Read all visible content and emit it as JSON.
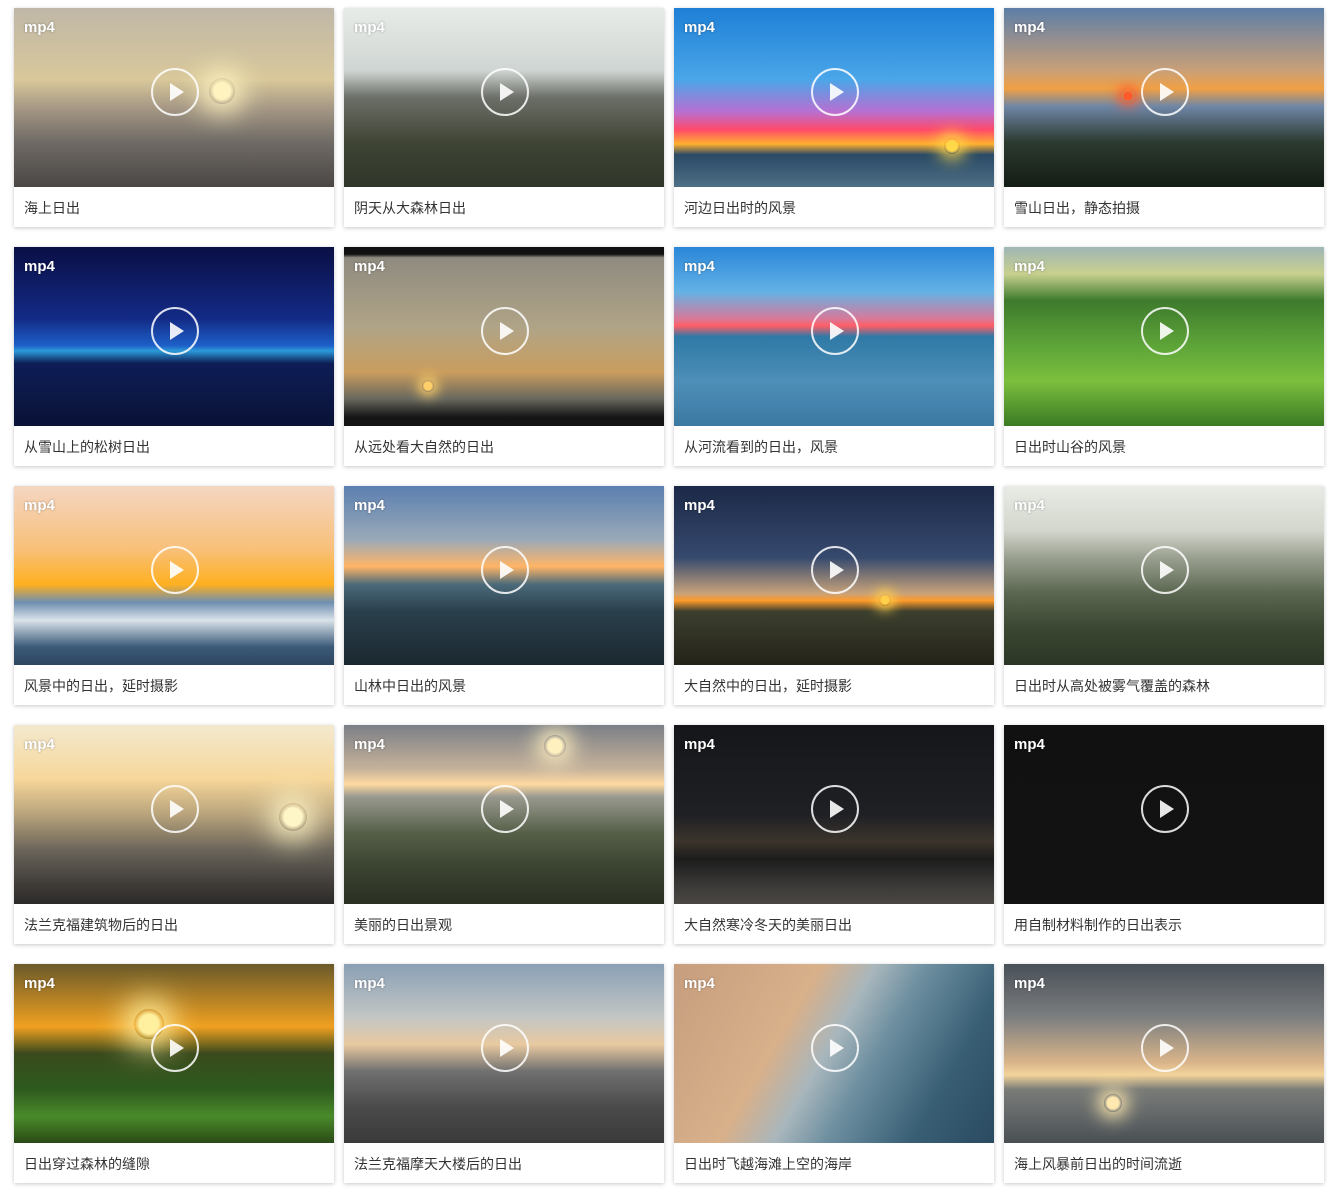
{
  "badge_label": "mp4",
  "videos": [
    {
      "title": "海上日出",
      "bg": "linear-gradient(180deg,#bfb7a8 0%,#d9c89a 40%,#a89a86 55%,#6f6a66 75%,#4b4744 100%)",
      "sun": "#fff3c0"
    },
    {
      "title": "阴天从大森林日出",
      "bg": "linear-gradient(180deg,#e8ece8 0%,#cfd5d2 35%,#6c6f68 50%,#3f4535 75%,#2f3528 100%)",
      "sun": ""
    },
    {
      "title": "河边日出时的风景",
      "bg": "linear-gradient(180deg,#1e7fd6 0%,#4aa6e8 40%,#b86fd2 58%,#ff4a6a 68%,#ffb02e 76%,#2a4a66 82%,#4f6f86 100%)",
      "sun": "#ffd84a"
    },
    {
      "title": "雪山日出，静态拍摄",
      "bg": "linear-gradient(180deg,#5d7ea8 0%,#c9a078 35%,#f0a044 45%,#6f86a6 55%,#2c3a2f 75%,#141c14 100%)",
      "sun": "#ff5a2a"
    },
    {
      "title": "从雪山上的松树日出",
      "bg": "linear-gradient(180deg,#0a0f45 0%,#132a86 40%,#1d5fc8 55%,#2b9ad8 58%,#0d1d56 65%,#0a1236 100%)",
      "sun": ""
    },
    {
      "title": "从远处看大自然的日出",
      "bg": "linear-gradient(180deg,#111 0%,#111 4%,#8f8b80 6%,#b0a487 45%,#c99d5e 70%,#67675e 85%,#151515 95%,#151515 100%)",
      "sun": "#ffcf6a"
    },
    {
      "title": "从河流看到的日出，风景",
      "bg": "linear-gradient(180deg,#2a86d8 0%,#63b2e6 25%,#d77a9a 40%,#ff5e66 44%,#2f79a6 50%,#4d8fb8 75%,#3b78a2 100%)",
      "sun": ""
    },
    {
      "title": "日出时山谷的风景",
      "bg": "linear-gradient(180deg,#9fb6b6 0%,#c8d08f 15%,#3e7a2c 30%,#5da438 55%,#7cbf3e 75%,#3a7a24 100%)",
      "sun": ""
    },
    {
      "title": "风景中的日出，延时摄影",
      "bg": "linear-gradient(180deg,#f4d6c2 0%,#f8c07a 35%,#ffb020 55%,#6f8eb0 65%,#d9e2ea 75%,#3b5a78 90%,#2e4660 100%)",
      "sun": ""
    },
    {
      "title": "山林中日出的风景",
      "bg": "linear-gradient(180deg,#5b7fb0 0%,#9aa9b8 30%,#ffb566 45%,#4b6a7a 55%,#2a3f4c 70%,#1b2830 100%)",
      "sun": ""
    },
    {
      "title": "大自然中的日出，延时摄影",
      "bg": "linear-gradient(180deg,#1c2847 0%,#364a6e 40%,#c7a27a 60%,#ff9a2a 64%,#3c3f2e 70%,#242319 100%)",
      "sun": "#ffd04a"
    },
    {
      "title": "日出时从高处被雾气覆盖的森林",
      "bg": "linear-gradient(180deg,#e9ece6 0%,#d2d6cc 25%,#9aa090 40%,#5a6650 60%,#3a4631 80%,#2c3626 100%)",
      "sun": ""
    },
    {
      "title": "法兰克福建筑物后的日出",
      "bg": "linear-gradient(180deg,#f3e9cf 0%,#f7d79a 30%,#b8a37c 50%,#6a6459 70%,#3d3a37 90%,#2c2a28 100%)",
      "sun": "#fff6c8"
    },
    {
      "title": "美丽的日出景观",
      "bg": "linear-gradient(180deg,#7b7f86 0%,#c8b39b 25%,#ffd9a0 33%,#9a9a90 40%,#566048 60%,#3a4230 80%,#2a3022 100%)",
      "sun": "#fff0c0"
    },
    {
      "title": "大自然寒冷冬天的美丽日出",
      "bg": "linear-gradient(180deg,#15161a 0%,#1f2024 50%,#3b342c 65%,#1c1c1c 75%,#3c3a38 90%,#4a4744 100%)",
      "sun": ""
    },
    {
      "title": "用自制材料制作的日出表示",
      "bg": "linear-gradient(180deg,#111111 0%,#121212 100%)",
      "sun": ""
    },
    {
      "title": "日出穿过森林的缝隙",
      "bg": "linear-gradient(180deg,#6a5a2a 0%,#f0a020 35%,#3a4a1c 50%,#2d5a1e 70%,#4a8a2a 85%,#2a4a16 100%)",
      "sun": "#fff0a0"
    },
    {
      "title": "法兰克福摩天大楼后的日出",
      "bg": "linear-gradient(180deg,#8aa0b6 0%,#c3c6c4 30%,#e8c9a0 45%,#707070 60%,#4a4a4a 80%,#3a3a3a 100%)",
      "sun": ""
    },
    {
      "title": "日出时飞越海滩上空的海岸",
      "bg": "linear-gradient(120deg,#c79e7e 0%,#d8b08a 35%,#a8b6bc 48%,#6d8fa0 60%,#395f75 80%,#2a4a60 100%)",
      "sun": ""
    },
    {
      "title": "海上风暴前日出的时间流逝",
      "bg": "linear-gradient(180deg,#4a5058 0%,#7c7f80 30%,#d9b48a 55%,#f4d49a 62%,#7a7c78 70%,#5a5f62 90%,#4a4f52 100%)",
      "sun": "#ffe9b0"
    }
  ]
}
